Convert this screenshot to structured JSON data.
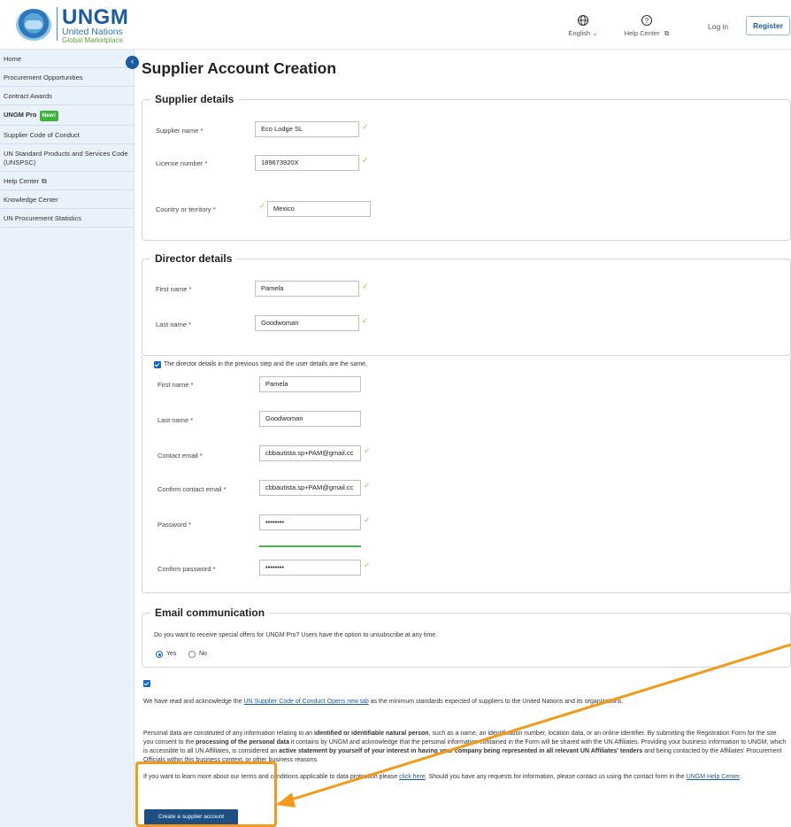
{
  "header": {
    "brand": "UNGM",
    "brand_sub1": "United Nations",
    "brand_sub2": "Global Marketplace",
    "language": "English",
    "help_center": "Help Center",
    "login": "Log in",
    "register": "Register"
  },
  "sidebar": {
    "items": [
      {
        "label": "Home"
      },
      {
        "label": "Procurement Opportunities"
      },
      {
        "label": "Contract Awards"
      },
      {
        "label": "UNGM Pro",
        "badge": "New!"
      },
      {
        "label": "Supplier Code of Conduct"
      },
      {
        "label": "UN Standard Products and Services Code (UNSPSC)"
      },
      {
        "label": "Help Center"
      },
      {
        "label": "Knowledge Center"
      },
      {
        "label": "UN Procurement Statistics"
      }
    ]
  },
  "page": {
    "title": "Supplier Account Creation"
  },
  "supplier": {
    "legend": "Supplier details",
    "name_label": "Supplier name *",
    "name_value": "Eco Lodge SL",
    "license_label": "License number  *",
    "license_value": "189673920X",
    "country_label": "Country or territory *",
    "country_value": "Mexico"
  },
  "director": {
    "legend": "Director details",
    "first_label": "First name *",
    "first_value": "Pamela",
    "last_label": "Last name *",
    "last_value": "Goodwoman"
  },
  "user": {
    "same_label": "The director details in the previous step and the user details are the same.",
    "first_label": "First name *",
    "first_value": "Pamela",
    "last_label": "Last name *",
    "last_value": "Goodwoman",
    "email_label": "Contact email *",
    "email_value": "cbbautista.sp+PAM@gmail.cc",
    "confirm_email_label": "Confirm contact email *",
    "confirm_email_value": "cbbautista.sp+PAM@gmail.cc",
    "password_label": "Password *",
    "password_value": "••••••••",
    "confirm_password_label": "Confirm password *",
    "confirm_password_value": "••••••••"
  },
  "email_comm": {
    "legend": "Email communication",
    "question": "Do you want to receive special offers for UNGM Pro? Users have the option to unsubscribe at any time.",
    "yes": "Yes",
    "no": "No"
  },
  "terms": {
    "ack_prefix": "We have read and acknowledge the ",
    "ack_link": "UN Supplier Code of Conduct Opens new tab",
    "ack_suffix": " as the minimum standards expected of suppliers to the United Nations and its organizations.",
    "p1": "Personal data are constituted of any information relating to an ",
    "p1_b1": "identified or identifiable natural person",
    "p2": ", such as a name, an identification number, location data, or an online identifier. By submitting the Registration Form for the site you consent to the ",
    "p2_b": "processing of the personal data",
    "p3": " it contains by UNGM and acknowledge that the personal information contained in the Form will be shared with the UN Affiliates. Providing your business information to UNGM, which is accessible to all UN Affiliates, is considered an ",
    "p3_b": "active statement by yourself of your interest in having your company being represented in all relevant UN Affiliates' tenders",
    "p4": " and being contacted by the Affiliates' Procurement Officials within this business context, or other business reasons.",
    "dp1": "If you want to learn more about our terms and conditions applicable to data protection please ",
    "dp_link": "click here",
    "dp2": ". Should you have any requests for information, please contact us using the contact form in the ",
    "dp_link2": "UNGM Help Center",
    "dp3": "."
  },
  "submit_label": "Create a supplier account",
  "colors": {
    "primary": "#1a5aa0",
    "highlight": "#f49a1b",
    "valid": "#9ccc3c"
  }
}
